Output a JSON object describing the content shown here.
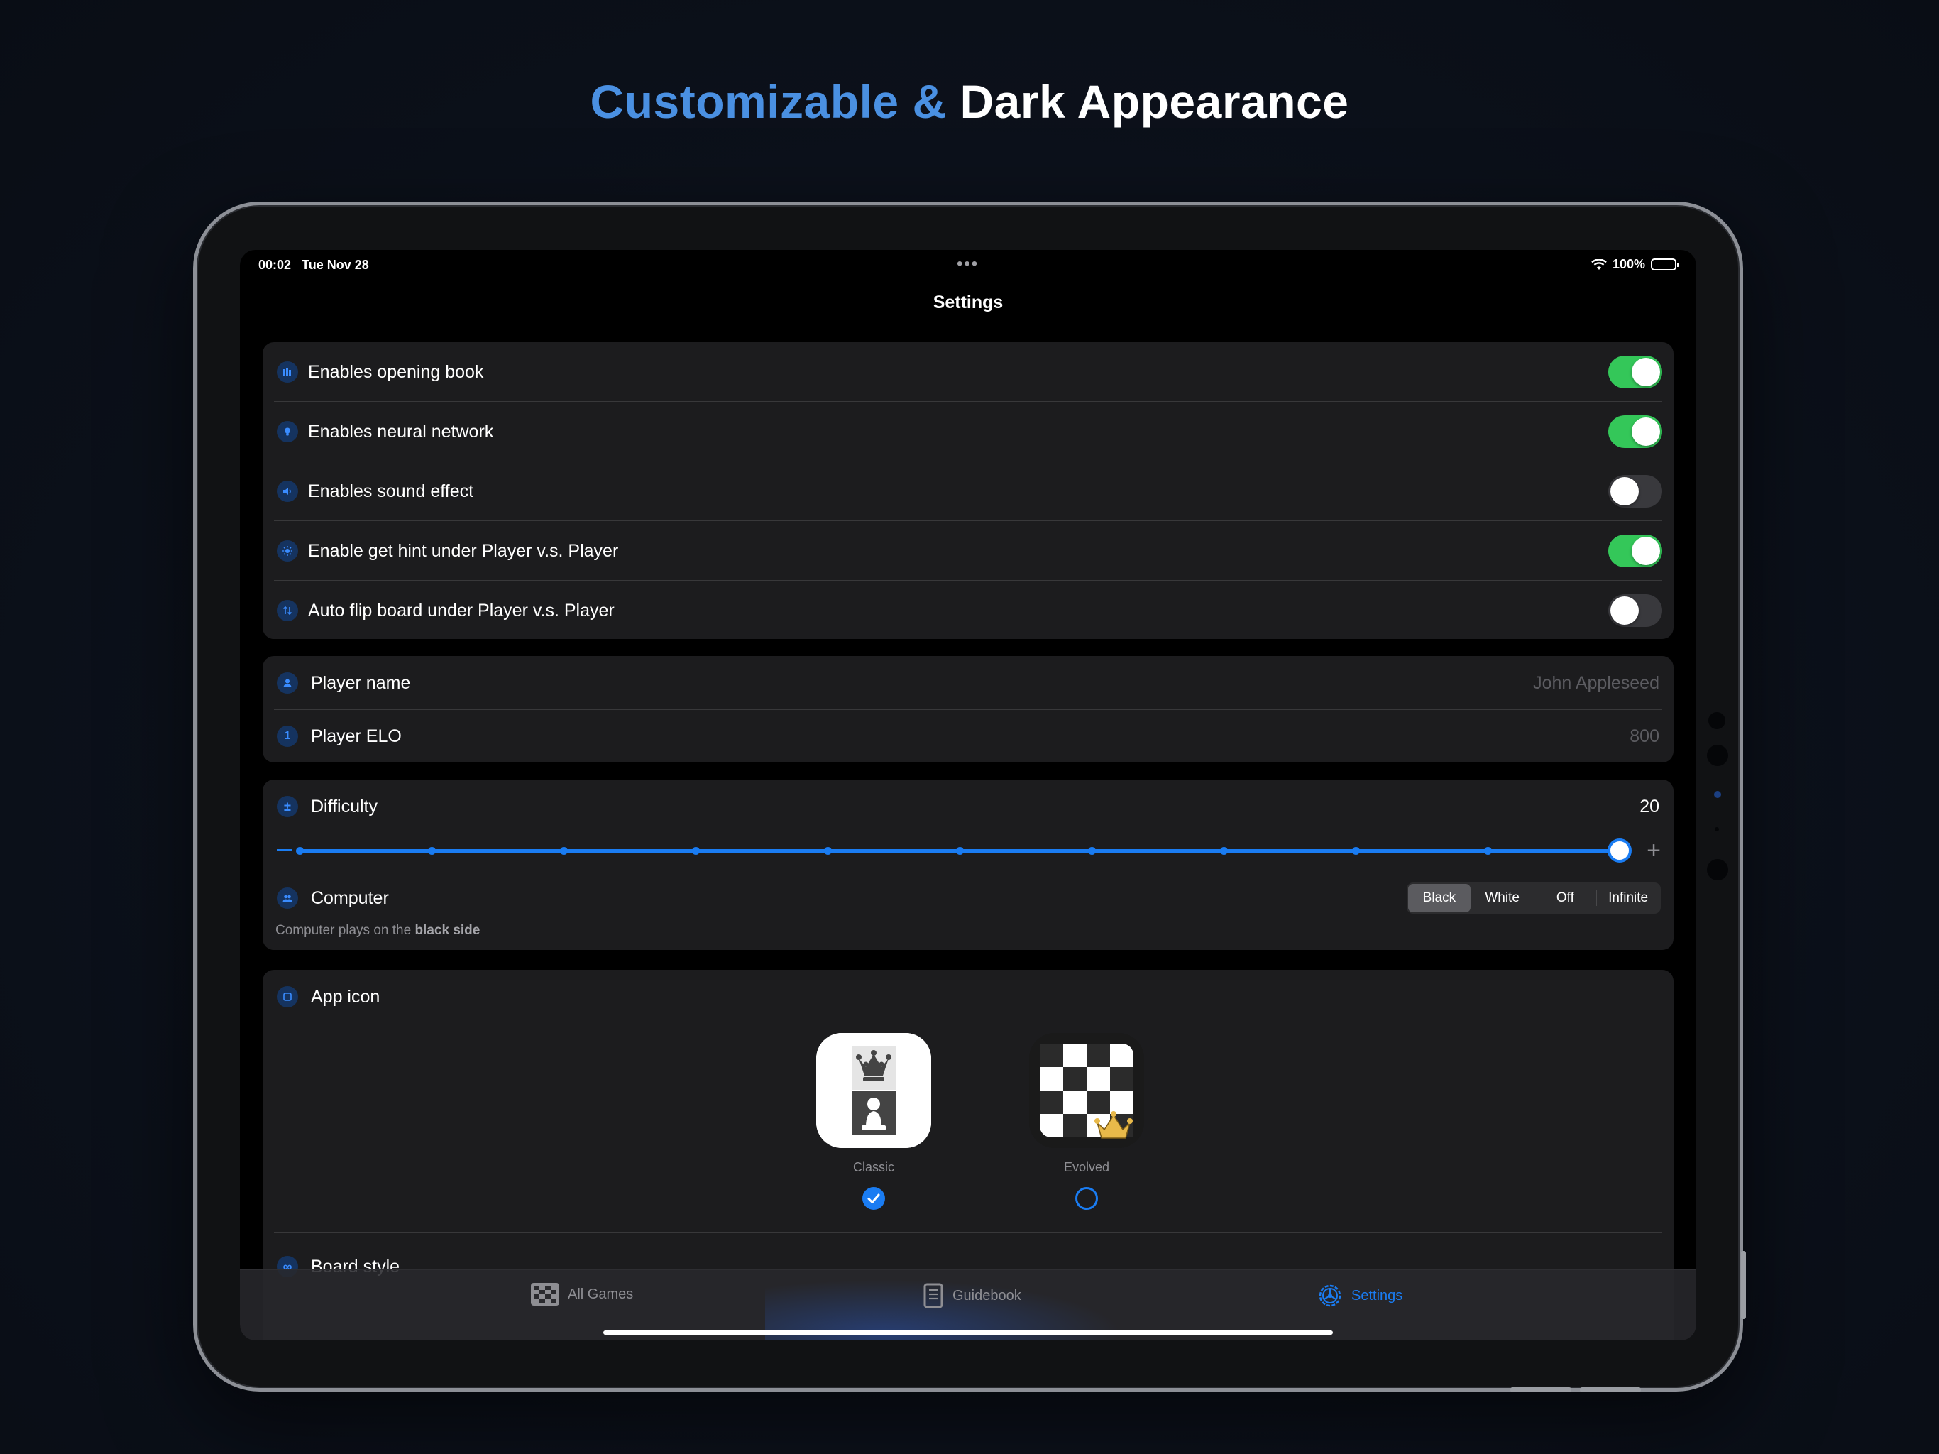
{
  "headline": {
    "accent": "Customizable &",
    "plain": "Dark Appearance"
  },
  "status": {
    "time": "00:02",
    "date": "Tue Nov 28",
    "dots": "•••",
    "battery": "100%"
  },
  "nav": {
    "title": "Settings"
  },
  "toggles": [
    {
      "label": "Enables opening book",
      "on": true,
      "icon": "books-icon"
    },
    {
      "label": "Enables neural network",
      "on": true,
      "icon": "lightbulb-icon"
    },
    {
      "label": "Enables sound effect",
      "on": false,
      "icon": "speaker-icon"
    },
    {
      "label": "Enable get hint under Player v.s. Player",
      "on": true,
      "icon": "sun-icon"
    },
    {
      "label": "Auto flip board under Player v.s. Player",
      "on": false,
      "icon": "flip-arrows-icon"
    }
  ],
  "player": {
    "name_label": "Player name",
    "name_value": "John Appleseed",
    "elo_label": "Player ELO",
    "elo_value": "800",
    "elo_icon_text": "1"
  },
  "difficulty": {
    "label": "Difficulty",
    "value": "20",
    "level": 20,
    "min": 0,
    "max": 20,
    "plus": "+"
  },
  "computer": {
    "label": "Computer",
    "options": [
      "Black",
      "White",
      "Off",
      "Infinite"
    ],
    "selected": "Black",
    "footnote_prefix": "Computer plays on the ",
    "footnote_bold": "black side"
  },
  "appicon": {
    "label": "App icon",
    "options": [
      {
        "name": "Classic",
        "selected": true
      },
      {
        "name": "Evolved",
        "selected": false
      }
    ]
  },
  "board_style": {
    "label": "Board style"
  },
  "tabbar": {
    "all_games": "All Games",
    "guidebook": "Guidebook",
    "settings": "Settings"
  },
  "colors": {
    "accent": "#1a7cf2",
    "toggle_on": "#34c759",
    "headline_accent": "#4a90e2",
    "background": "#0c111b"
  }
}
